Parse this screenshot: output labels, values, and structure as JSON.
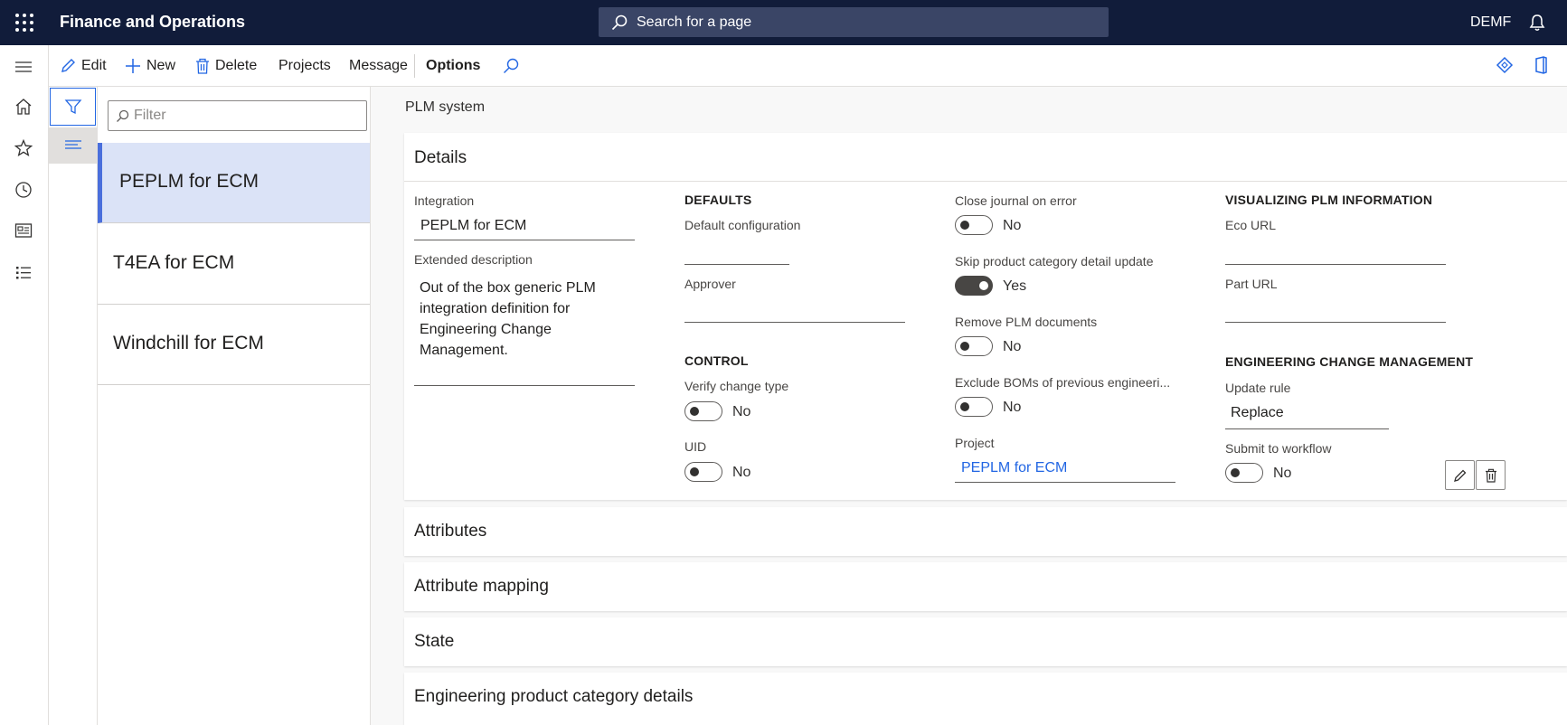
{
  "app": {
    "title": "Finance and Operations",
    "company": "DEMF"
  },
  "search": {
    "placeholder": "Search for a page"
  },
  "toolbar": {
    "edit": "Edit",
    "new": "New",
    "delete": "Delete",
    "projects": "Projects",
    "message": "Message",
    "options": "Options"
  },
  "list": {
    "filter_placeholder": "Filter",
    "items": [
      {
        "label": "PEPLM for ECM",
        "selected": true
      },
      {
        "label": "T4EA for ECM",
        "selected": false
      },
      {
        "label": "Windchill for ECM",
        "selected": false
      }
    ]
  },
  "page": {
    "caption": "PLM system"
  },
  "details": {
    "title": "Details",
    "integration_label": "Integration",
    "integration_value": "PEPLM for ECM",
    "ext_desc_label": "Extended description",
    "ext_desc_value": "Out of the box generic PLM integration definition for Engineering Change Management.",
    "defaults_header": "DEFAULTS",
    "default_config_label": "Default configuration",
    "default_config_value": "",
    "approver_label": "Approver",
    "approver_value": "",
    "control_header": "CONTROL",
    "verify_label": "Verify change type",
    "verify_value": "No",
    "uid_label": "UID",
    "uid_value": "No",
    "close_journal_label": "Close journal on error",
    "close_journal_value": "No",
    "skip_label": "Skip product category detail update",
    "skip_value": "Yes",
    "remove_docs_label": "Remove PLM documents",
    "remove_docs_value": "No",
    "exclude_boms_label": "Exclude BOMs of previous engineeri...",
    "exclude_boms_value": "No",
    "project_label": "Project",
    "project_value": "PEPLM for ECM",
    "visualizing_header": "VISUALIZING PLM INFORMATION",
    "eco_url_label": "Eco URL",
    "eco_url_value": "",
    "part_url_label": "Part URL",
    "part_url_value": "",
    "ecm_header": "ENGINEERING CHANGE MANAGEMENT",
    "update_rule_label": "Update rule",
    "update_rule_value": "Replace",
    "submit_label": "Submit to workflow",
    "submit_value": "No"
  },
  "fasttabs": [
    {
      "title": "Attributes"
    },
    {
      "title": "Attribute mapping"
    },
    {
      "title": "State"
    },
    {
      "title": "Engineering product category details"
    }
  ],
  "colors": {
    "topbar": "#111c3a",
    "accent": "#2266e3",
    "selected_row": "#dbe3f7"
  }
}
